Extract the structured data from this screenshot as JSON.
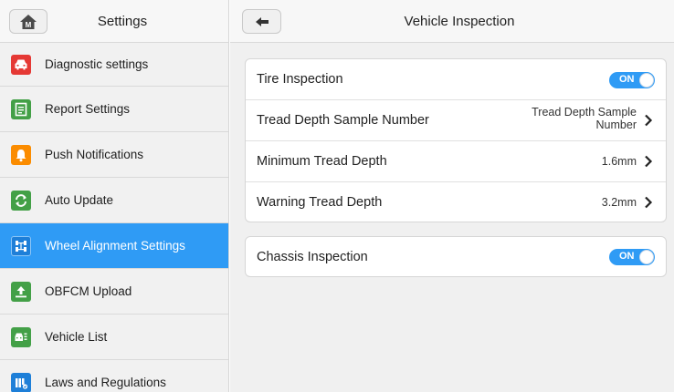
{
  "sidebar": {
    "title": "Settings",
    "items": [
      {
        "label": "Diagnostic settings",
        "icon": "car-icon",
        "color": "#e53935"
      },
      {
        "label": "Report Settings",
        "icon": "report-icon",
        "color": "#43a047"
      },
      {
        "label": "Push Notifications",
        "icon": "bell-icon",
        "color": "#fb8c00"
      },
      {
        "label": "Auto Update",
        "icon": "refresh-icon",
        "color": "#43a047"
      },
      {
        "label": "Wheel Alignment Settings",
        "icon": "alignment-icon",
        "color": "#1e7fd8",
        "active": true
      },
      {
        "label": "OBFCM Upload",
        "icon": "upload-icon",
        "color": "#43a047"
      },
      {
        "label": "Vehicle List",
        "icon": "vehicle-list-icon",
        "color": "#43a047"
      },
      {
        "label": "Laws and Regulations",
        "icon": "regulations-icon",
        "color": "#1e7fd8"
      }
    ]
  },
  "header": {
    "title": "Vehicle Inspection"
  },
  "tire": {
    "label": "Tire Inspection",
    "toggle": "ON"
  },
  "tread_sample": {
    "label": "Tread Depth Sample Number",
    "value_line1": "Tread Depth Sample",
    "value_line2": "Number"
  },
  "min_tread": {
    "label": "Minimum Tread Depth",
    "value": "1.6mm"
  },
  "warn_tread": {
    "label": "Warning Tread Depth",
    "value": "3.2mm"
  },
  "chassis": {
    "label": "Chassis Inspection",
    "toggle": "ON"
  },
  "colors": {
    "accent": "#2f9bf5"
  }
}
